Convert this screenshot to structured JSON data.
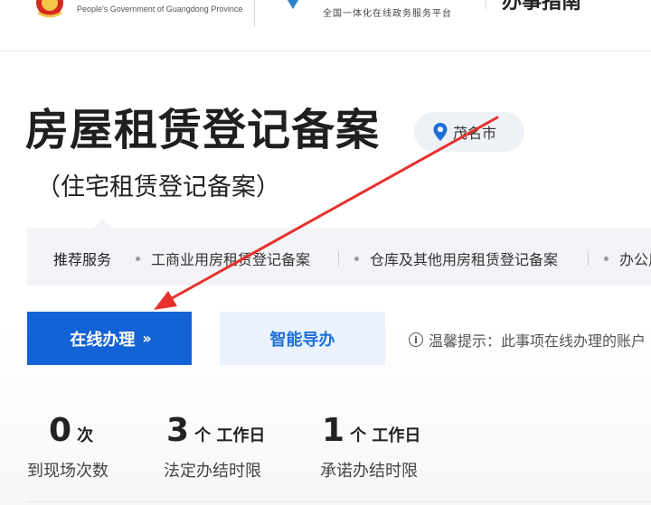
{
  "header": {
    "gov_subtitle": "People's Government of Guangdong Province",
    "platform_subtitle": "全国一体化在线政务服务平台",
    "guide_title": "办事指南"
  },
  "service": {
    "title": "房屋租赁登记备案",
    "subtitle": "（住宅租赁登记备案）",
    "location": "茂名市",
    "location_icon": "map-pin-icon"
  },
  "recommended": {
    "label": "推荐服务",
    "items": [
      "工商业用房租赁登记备案",
      "仓库及其他用房租赁登记备案",
      "办公用"
    ]
  },
  "actions": {
    "online_label": "在线办理",
    "online_icon": "double-chevron-right-icon",
    "guide_label": "智能导办",
    "tip_icon": "info-circle-icon",
    "tip_text": "温馨提示：此事项在线办理的账户"
  },
  "stats": [
    {
      "value": "0",
      "unit": "次",
      "label": "到现场次数"
    },
    {
      "value": "3",
      "unit": "个 工作日",
      "label": "法定办结时限"
    },
    {
      "value": "1",
      "unit": "个 工作日",
      "label": "承诺办结时限"
    }
  ],
  "colors": {
    "primary": "#1463d6",
    "secondary_bg": "#eaf2fd",
    "annotation": "#e8302c",
    "location_pin": "#1f6fd6"
  }
}
